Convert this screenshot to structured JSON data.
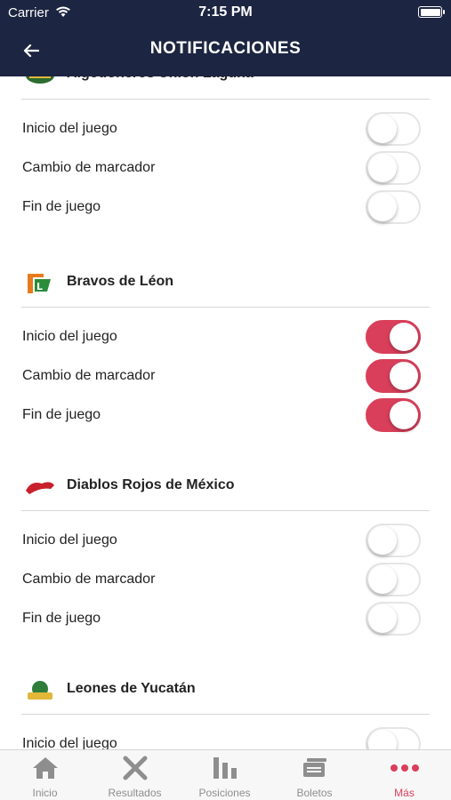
{
  "status": {
    "carrier": "Carrier",
    "time": "7:15 PM"
  },
  "header": {
    "title": "NOTIFICACIONES"
  },
  "teams": [
    {
      "name": "Algodoneros Unión Laguna",
      "toggles": [
        {
          "label": "Inicio del juego",
          "on": false
        },
        {
          "label": "Cambio de marcador",
          "on": false
        },
        {
          "label": "Fin de juego",
          "on": false
        }
      ]
    },
    {
      "name": "Bravos de Léon",
      "toggles": [
        {
          "label": "Inicio del juego",
          "on": true
        },
        {
          "label": "Cambio de marcador",
          "on": true
        },
        {
          "label": "Fin de juego",
          "on": true
        }
      ]
    },
    {
      "name": "Diablos Rojos de México",
      "toggles": [
        {
          "label": "Inicio del juego",
          "on": false
        },
        {
          "label": "Cambio de marcador",
          "on": false
        },
        {
          "label": "Fin de juego",
          "on": false
        }
      ]
    },
    {
      "name": "Leones de Yucatán",
      "toggles": [
        {
          "label": "Inicio del juego",
          "on": false
        }
      ]
    }
  ],
  "tabs": [
    {
      "label": "Inicio",
      "icon": "home-icon"
    },
    {
      "label": "Resultados",
      "icon": "crossed-bats-icon"
    },
    {
      "label": "Posiciones",
      "icon": "bar-chart-icon"
    },
    {
      "label": "Boletos",
      "icon": "tickets-icon"
    },
    {
      "label": "Más",
      "icon": "more-dots-icon"
    }
  ],
  "colors": {
    "navy": "#1c2541",
    "accent": "#d93f5b"
  }
}
